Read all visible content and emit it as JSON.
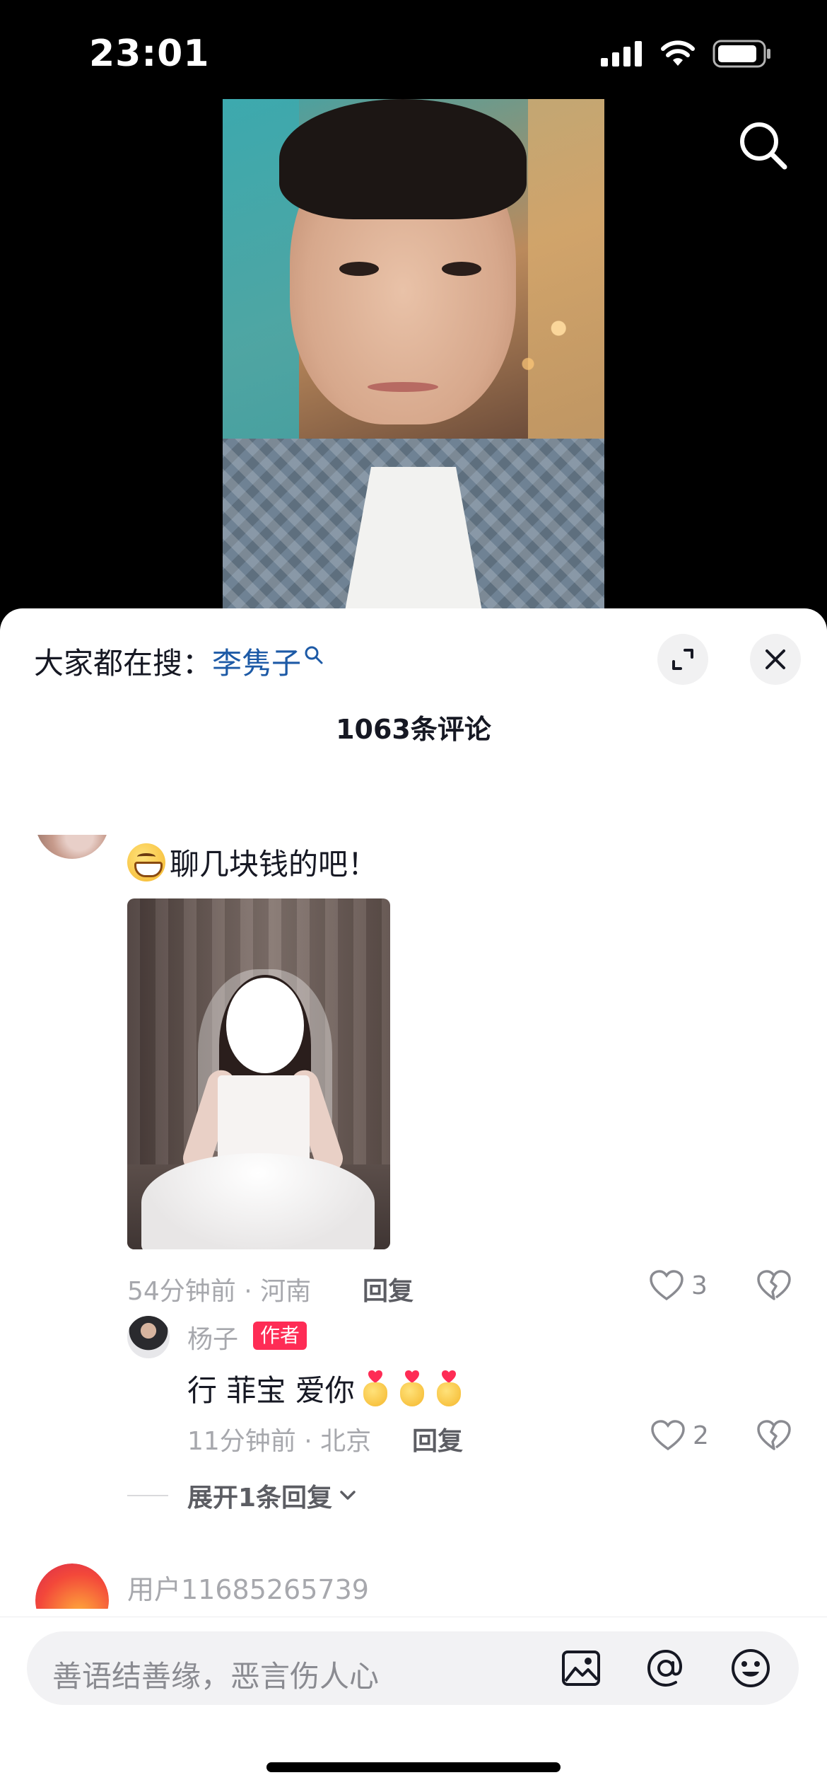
{
  "status_bar": {
    "time": "23:01"
  },
  "sheet": {
    "hot_search_label": "大家都在搜：",
    "hot_search_keyword": "李隽子",
    "comment_count": "1063条评论"
  },
  "comments": [
    {
      "text": "聊几块钱的吧！",
      "time_location": "54分钟前 · 河南",
      "reply_label": "回复",
      "likes": "3",
      "replies": [
        {
          "username": "杨子",
          "badge": "作者",
          "text": "行 菲宝 爱你",
          "time_location": "11分钟前 · 北京",
          "reply_label": "回复",
          "likes": "2"
        }
      ],
      "expand_label": "展开1条回复"
    },
    {
      "username": "用户11685265739"
    }
  ],
  "input": {
    "placeholder": "善语结善缘，恶言伤人心"
  },
  "icons": {
    "search": "search-icon",
    "expand": "expand-icon",
    "close": "close-icon",
    "like": "heart-icon",
    "dislike": "broken-heart-icon",
    "image": "image-icon",
    "mention": "at-icon",
    "emoji": "emoji-icon"
  },
  "colors": {
    "accent": "#fe2c55",
    "keyword": "#1d5aa6",
    "muted": "#a7a8ad"
  }
}
